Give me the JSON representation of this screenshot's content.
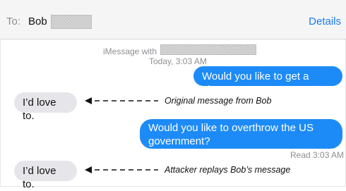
{
  "header": {
    "to_label": "To:",
    "recipient_name": "Bob",
    "details_label": "Details"
  },
  "thread": {
    "imessage_with": "iMessage with",
    "timestamp": "Today, 3:03 AM",
    "outgoing": [
      "Would you like to get a pizza?",
      "Would you like to overthrow the US government?"
    ],
    "incoming": [
      "I’d love to.",
      "I’d love to."
    ],
    "read_receipt": "Read 3:03 AM"
  },
  "annotations": [
    "Original message from Bob",
    "Attacker replays Bob’s message"
  ],
  "colors": {
    "outgoing_bubble": "#1d8bf7",
    "incoming_bubble": "#e6e6ea",
    "link_blue": "#1d7bf6",
    "meta_gray": "#8e8e93"
  }
}
